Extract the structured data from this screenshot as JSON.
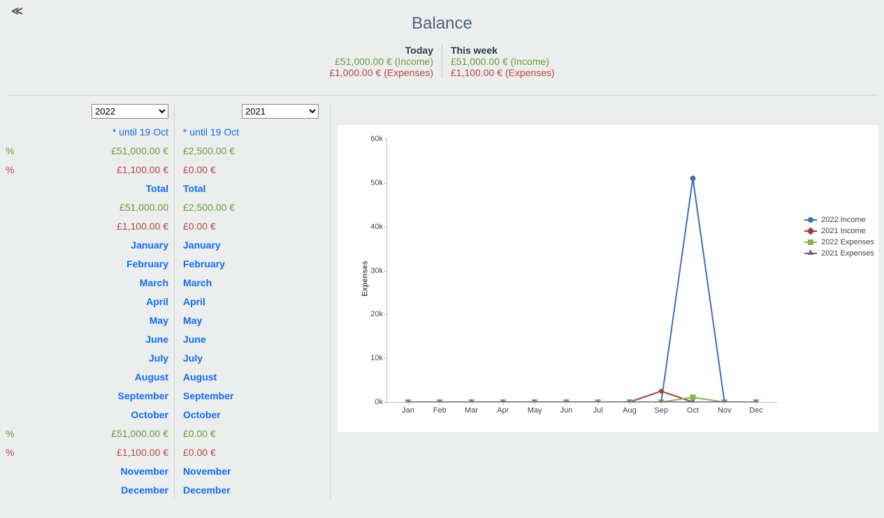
{
  "title": "Balance",
  "summary": {
    "today_label": "Today",
    "today_income": "£51,000.00 € (Income)",
    "today_expenses": "£1,000.00 € (Expenses)",
    "week_label": "This week",
    "week_income": "£51,000.00 € (Income)",
    "week_expenses": "£1,100.00 € (Expenses)"
  },
  "colA": {
    "year": "2022",
    "note": "* until 19 Oct",
    "ytd_income": "£51,000.00 €",
    "ytd_expenses": "£1,100.00 €",
    "total_hdr": "Total",
    "total_income": "£51,000.00",
    "total_expenses": "£1,100.00 €",
    "months": [
      "January",
      "February",
      "March",
      "April",
      "May",
      "June",
      "July",
      "August",
      "September",
      "October"
    ],
    "oct_income": "£51,000.00 €",
    "oct_expenses": "£1,100.00 €",
    "months_rest": [
      "November",
      "December"
    ]
  },
  "colB": {
    "year": "2021",
    "note": "* until 19 Oct",
    "ytd_income": "£2,500.00 €",
    "ytd_expenses": "£0.00 €",
    "total_hdr": "Total",
    "total_income": "£2,500.00 €",
    "total_expenses": "£0.00 €",
    "months": [
      "January",
      "February",
      "March",
      "April",
      "May",
      "June",
      "July",
      "August",
      "September",
      "October"
    ],
    "oct_income": "£0.00 €",
    "oct_expenses": "£0.00 €",
    "months_rest": [
      "November",
      "December"
    ]
  },
  "pct_label": "%",
  "chart_data": {
    "type": "line",
    "x": [
      "Jan",
      "Feb",
      "Mar",
      "Apr",
      "May",
      "Jun",
      "Jul",
      "Aug",
      "Sep",
      "Oct",
      "Nov",
      "Dec"
    ],
    "series": [
      {
        "name": "2022 Income",
        "color": "#3e72ae",
        "values": [
          0,
          0,
          0,
          0,
          0,
          0,
          0,
          0,
          0,
          51000,
          0,
          0
        ]
      },
      {
        "name": "2021 Income",
        "color": "#a83c3a",
        "values": [
          0,
          0,
          0,
          0,
          0,
          0,
          0,
          0,
          2500,
          0,
          0,
          0
        ]
      },
      {
        "name": "2022 Expenses",
        "color": "#8cb14e",
        "values": [
          0,
          0,
          0,
          0,
          0,
          0,
          0,
          0,
          0,
          1100,
          0,
          0
        ]
      },
      {
        "name": "2021 Expenses",
        "color": "#6b5d91",
        "values": [
          0,
          0,
          0,
          0,
          0,
          0,
          0,
          0,
          0,
          0,
          0,
          0
        ]
      }
    ],
    "ylabel": "Expenses",
    "ylim": [
      0,
      60000
    ],
    "yticks": [
      0,
      10000,
      20000,
      30000,
      40000,
      50000,
      60000
    ],
    "ytick_labels": [
      "0k",
      "10k",
      "20k",
      "30k",
      "40k",
      "50k",
      "60k"
    ]
  }
}
